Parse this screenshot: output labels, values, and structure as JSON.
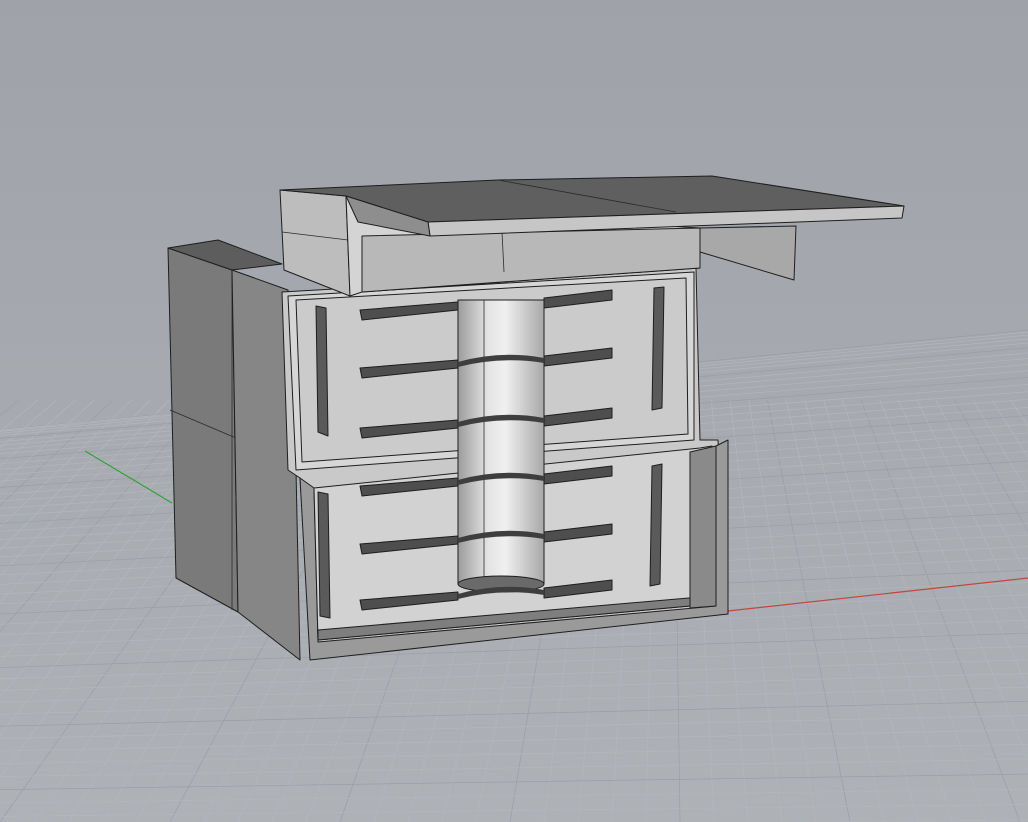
{
  "viewport": {
    "projection": "perspective",
    "display_mode": "shaded",
    "grid": true
  },
  "colors": {
    "background": "#a6aab0",
    "grid_minor": "#b3b7bc",
    "grid_major": "#9a9ea4",
    "x_axis": "#c0473f",
    "y_axis": "#2fa23a",
    "surface_light": "#cfcfcf",
    "surface_mid": "#a9a9a9",
    "surface_dark": "#6b6b6b",
    "edge": "#1e1e1e"
  },
  "model": {
    "parts": [
      "outer-housing",
      "top-cover-plate",
      "inner-tray-upper",
      "inner-tray-lower",
      "center-cylinder",
      "shelf-slots",
      "side-slots"
    ]
  }
}
